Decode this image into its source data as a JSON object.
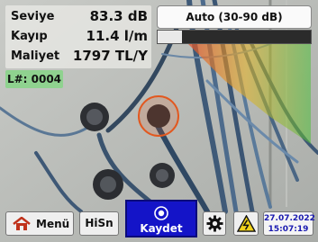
{
  "readout": {
    "level_label": "Seviye",
    "level_value": "83.3 dB",
    "loss_label": "Kayıp",
    "loss_value": "11.4 l/m",
    "cost_label": "Maliyet",
    "cost_value": "1797 TL/Y"
  },
  "leak_number": "L#: 0004",
  "mode_button": "Auto (30-90 dB)",
  "level_indicator": {
    "fill_fraction": 0.16
  },
  "toolbar": {
    "menu_label": "Menü",
    "hisn_label": "HiSn",
    "save_label": "Kaydet",
    "date": "27.07.2022",
    "time": "15:07:19"
  },
  "colors": {
    "save_button": "#1414c8",
    "target_circle": "#e2581f",
    "leak_number_bg": "#8fd28f",
    "datetime_text": "#1a1ab0"
  },
  "icons": [
    "home-icon",
    "camera-icon",
    "gear-icon",
    "warning-icon"
  ]
}
